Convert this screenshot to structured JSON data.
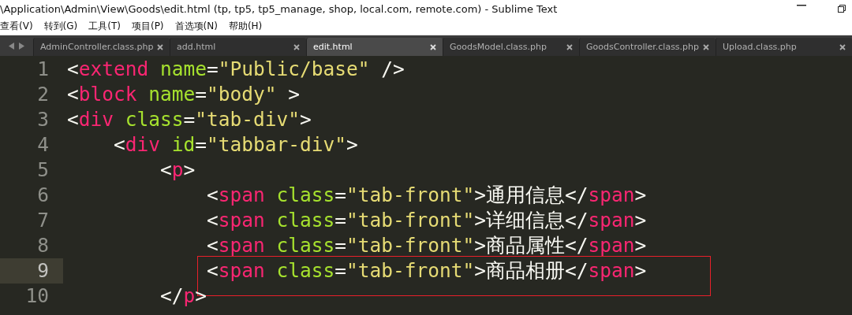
{
  "window": {
    "title": "\\Application\\Admin\\View\\Goods\\edit.html (tp, tp5, tp5_manage, shop, local.com, remote.com) - Sublime Text"
  },
  "menu": [
    "查看(V)",
    "转到(G)",
    "工具(T)",
    "项目(P)",
    "首选项(N)",
    "帮助(H)"
  ],
  "tabs": [
    {
      "label": "AdminController.class.php",
      "selected": false
    },
    {
      "label": "add.html",
      "selected": false
    },
    {
      "label": "edit.html",
      "selected": true
    },
    {
      "label": "GoodsModel.class.php",
      "selected": false
    },
    {
      "label": "GoodsController.class.php",
      "selected": false
    },
    {
      "label": "Upload.class.php",
      "selected": false
    }
  ],
  "editor": {
    "lines": [
      {
        "number": "1",
        "current": false,
        "boxed": false,
        "tokens": [
          {
            "kind": "punct",
            "text": "<"
          },
          {
            "kind": "tag",
            "text": "extend"
          },
          {
            "kind": "attr",
            "text": " name"
          },
          {
            "kind": "punct",
            "text": "="
          },
          {
            "kind": "string",
            "text": "\"Public/base\""
          },
          {
            "kind": "punct",
            "text": " />"
          }
        ]
      },
      {
        "number": "2",
        "current": false,
        "boxed": false,
        "tokens": [
          {
            "kind": "punct",
            "text": "<"
          },
          {
            "kind": "tag",
            "text": "block"
          },
          {
            "kind": "attr",
            "text": " name"
          },
          {
            "kind": "punct",
            "text": "="
          },
          {
            "kind": "string",
            "text": "\"body\""
          },
          {
            "kind": "punct",
            "text": " >"
          }
        ]
      },
      {
        "number": "3",
        "current": false,
        "boxed": false,
        "tokens": [
          {
            "kind": "punct",
            "text": "<"
          },
          {
            "kind": "tag",
            "text": "div"
          },
          {
            "kind": "attr",
            "text": " class"
          },
          {
            "kind": "punct",
            "text": "="
          },
          {
            "kind": "string",
            "text": "\"tab-div\""
          },
          {
            "kind": "punct",
            "text": ">"
          }
        ]
      },
      {
        "number": "4",
        "current": false,
        "boxed": false,
        "tokens": [
          {
            "kind": "punct",
            "text": "    <"
          },
          {
            "kind": "tag",
            "text": "div"
          },
          {
            "kind": "attr",
            "text": " id"
          },
          {
            "kind": "punct",
            "text": "="
          },
          {
            "kind": "string",
            "text": "\"tabbar-div\""
          },
          {
            "kind": "punct",
            "text": ">"
          }
        ]
      },
      {
        "number": "5",
        "current": false,
        "boxed": false,
        "tokens": [
          {
            "kind": "punct",
            "text": "        <"
          },
          {
            "kind": "tag",
            "text": "p"
          },
          {
            "kind": "punct",
            "text": ">"
          }
        ]
      },
      {
        "number": "6",
        "current": false,
        "boxed": false,
        "tokens": [
          {
            "kind": "punct",
            "text": "            <"
          },
          {
            "kind": "tag",
            "text": "span"
          },
          {
            "kind": "attr",
            "text": " class"
          },
          {
            "kind": "punct",
            "text": "="
          },
          {
            "kind": "string",
            "text": "\"tab-front\""
          },
          {
            "kind": "punct",
            "text": ">通用信息</"
          },
          {
            "kind": "tag",
            "text": "span"
          },
          {
            "kind": "punct",
            "text": ">"
          }
        ]
      },
      {
        "number": "7",
        "current": false,
        "boxed": false,
        "tokens": [
          {
            "kind": "punct",
            "text": "            <"
          },
          {
            "kind": "tag",
            "text": "span"
          },
          {
            "kind": "attr",
            "text": " class"
          },
          {
            "kind": "punct",
            "text": "="
          },
          {
            "kind": "string",
            "text": "\"tab-front\""
          },
          {
            "kind": "punct",
            "text": ">详细信息</"
          },
          {
            "kind": "tag",
            "text": "span"
          },
          {
            "kind": "punct",
            "text": ">"
          }
        ]
      },
      {
        "number": "8",
        "current": false,
        "boxed": false,
        "tokens": [
          {
            "kind": "punct",
            "text": "            <"
          },
          {
            "kind": "tag",
            "text": "span"
          },
          {
            "kind": "attr",
            "text": " class"
          },
          {
            "kind": "punct",
            "text": "="
          },
          {
            "kind": "string",
            "text": "\"tab-front\""
          },
          {
            "kind": "punct",
            "text": ">商品属性</"
          },
          {
            "kind": "tag",
            "text": "span"
          },
          {
            "kind": "punct",
            "text": ">"
          }
        ]
      },
      {
        "number": "9",
        "current": true,
        "boxed": true,
        "tokens": [
          {
            "kind": "punct",
            "text": "            <"
          },
          {
            "kind": "tag",
            "text": "span"
          },
          {
            "kind": "attr",
            "text": " class"
          },
          {
            "kind": "punct",
            "text": "="
          },
          {
            "kind": "string",
            "text": "\"tab-front\""
          },
          {
            "kind": "punct",
            "text": ">商品相册</"
          },
          {
            "kind": "tag",
            "text": "span"
          },
          {
            "kind": "punct",
            "text": ">"
          }
        ]
      },
      {
        "number": "10",
        "current": false,
        "boxed": false,
        "tokens": [
          {
            "kind": "punct",
            "text": "        </"
          },
          {
            "kind": "tag",
            "text": "p"
          },
          {
            "kind": "punct",
            "text": ">"
          }
        ]
      }
    ]
  }
}
